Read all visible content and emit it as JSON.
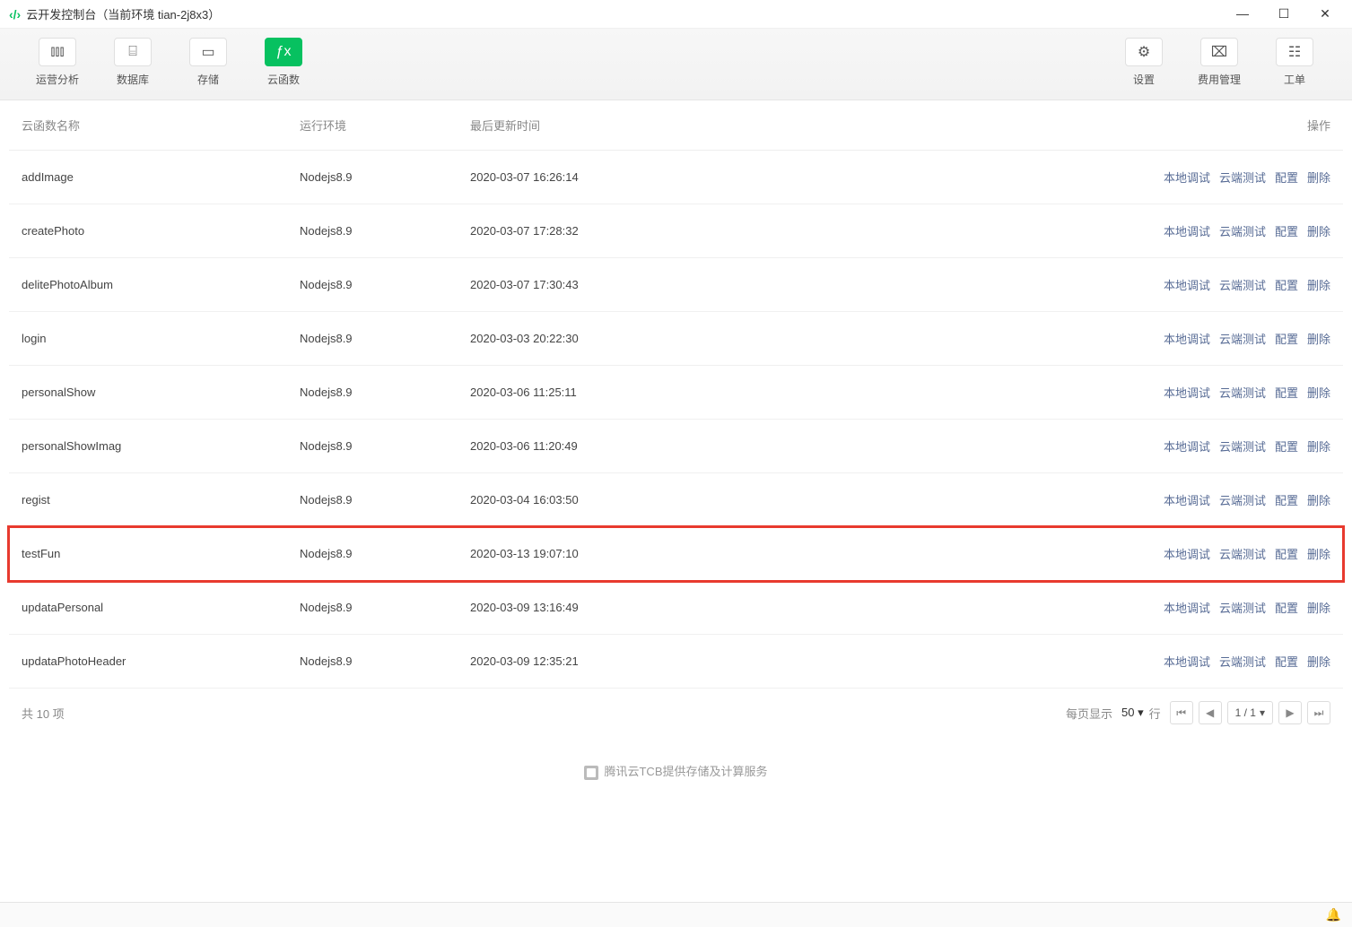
{
  "window": {
    "title": "云开发控制台（当前环境 tian-2j8x3）"
  },
  "toolbar": {
    "left": [
      {
        "key": "analytics",
        "label": "运营分析",
        "icon": "bar-chart-icon",
        "glyph": "⫾⫾⫾"
      },
      {
        "key": "database",
        "label": "数据库",
        "icon": "database-icon",
        "glyph": "⌸"
      },
      {
        "key": "storage",
        "label": "存储",
        "icon": "storage-icon",
        "glyph": "▭"
      },
      {
        "key": "functions",
        "label": "云函数",
        "icon": "function-icon",
        "glyph": "ƒx",
        "active": true
      }
    ],
    "right": [
      {
        "key": "settings",
        "label": "设置",
        "icon": "gear-icon",
        "glyph": "⚙"
      },
      {
        "key": "billing",
        "label": "费用管理",
        "icon": "wallet-icon",
        "glyph": "⌧"
      },
      {
        "key": "ticket",
        "label": "工单",
        "icon": "ticket-icon",
        "glyph": "☷"
      }
    ]
  },
  "table": {
    "headers": {
      "name": "云函数名称",
      "env": "运行环境",
      "time": "最后更新时间",
      "actions": "操作"
    },
    "action_labels": {
      "local": "本地调试",
      "cloud": "云端测试",
      "config": "配置",
      "delete": "删除"
    },
    "rows": [
      {
        "name": "addImage",
        "env": "Nodejs8.9",
        "time": "2020-03-07 16:26:14"
      },
      {
        "name": "createPhoto",
        "env": "Nodejs8.9",
        "time": "2020-03-07 17:28:32"
      },
      {
        "name": "delitePhotoAlbum",
        "env": "Nodejs8.9",
        "time": "2020-03-07 17:30:43"
      },
      {
        "name": "login",
        "env": "Nodejs8.9",
        "time": "2020-03-03 20:22:30"
      },
      {
        "name": "personalShow",
        "env": "Nodejs8.9",
        "time": "2020-03-06 11:25:11"
      },
      {
        "name": "personalShowImag",
        "env": "Nodejs8.9",
        "time": "2020-03-06 11:20:49"
      },
      {
        "name": "regist",
        "env": "Nodejs8.9",
        "time": "2020-03-04 16:03:50"
      },
      {
        "name": "testFun",
        "env": "Nodejs8.9",
        "time": "2020-03-13 19:07:10",
        "highlight": true
      },
      {
        "name": "updataPersonal",
        "env": "Nodejs8.9",
        "time": "2020-03-09 13:16:49"
      },
      {
        "name": "updataPhotoHeader",
        "env": "Nodejs8.9",
        "time": "2020-03-09 12:35:21"
      }
    ]
  },
  "footer": {
    "total_text": "共 10 项",
    "per_page_label": "每页显示",
    "per_page_value": "50",
    "unit": "行",
    "page_indicator": "1 / 1"
  },
  "tcb_text": "腾讯云TCB提供存储及计算服务"
}
